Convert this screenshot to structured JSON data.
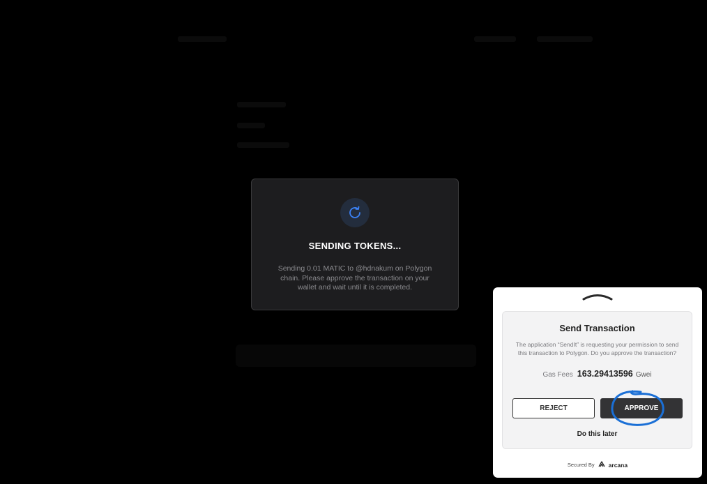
{
  "sending_modal": {
    "icon": "refresh-icon",
    "title": "SENDING TOKENS...",
    "description": "Sending 0.01 MATIC to @hdnakum on Polygon chain. Please approve the transaction on your wallet and wait until it is completed."
  },
  "wallet": {
    "title": "Send Transaction",
    "description": "The application “SendIt” is requesting your permission to send this transaction to Polygon. Do you approve the transaction?",
    "gas_label": "Gas Fees",
    "gas_value": "163.29413596",
    "gas_unit": "Gwei",
    "reject_label": "REJECT",
    "approve_label": "APPROVE",
    "later_label": "Do this later",
    "secured_by": "Secured By",
    "brand": "arcana"
  },
  "colors": {
    "background": "#000000",
    "modal_bg": "#1d1d1f",
    "spinner_accent": "#3b82f6",
    "annotation_blue": "#1a6fd6",
    "approve_bg": "#333335"
  }
}
